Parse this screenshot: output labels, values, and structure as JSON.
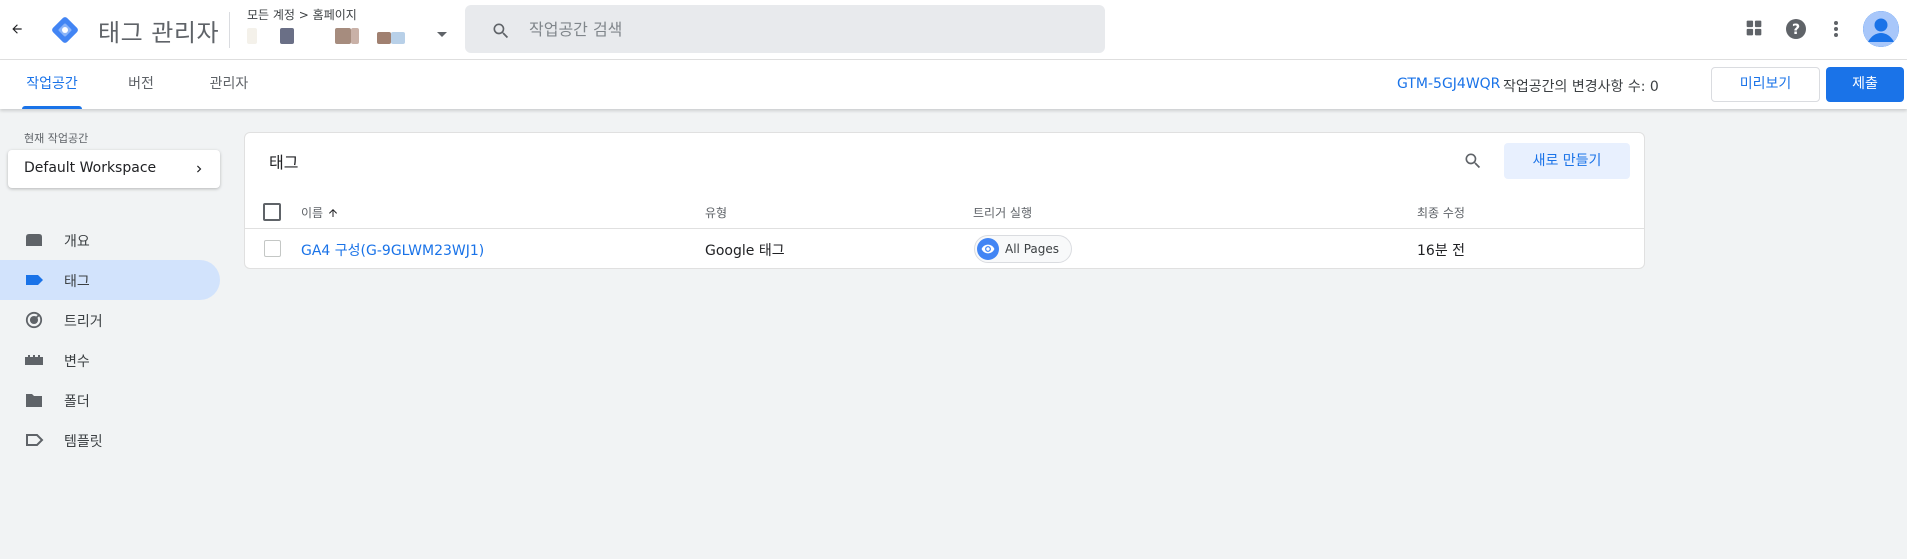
{
  "header": {
    "app_title": "태그 관리자",
    "breadcrumb": "모든 계정 > 홈페이지",
    "search_placeholder": "작업공간 검색"
  },
  "tabs": [
    {
      "label": "작업공간",
      "active": true
    },
    {
      "label": "버전",
      "active": false
    },
    {
      "label": "관리자",
      "active": false
    }
  ],
  "toolbar": {
    "container_id": "GTM-5GJ4WQR",
    "changes_label": "작업공간의 변경사항 수: 0",
    "preview_label": "미리보기",
    "submit_label": "제출"
  },
  "sidebar": {
    "workspace_caption": "현재 작업공간",
    "workspace_name": "Default Workspace",
    "items": [
      {
        "label": "개요",
        "icon": "overview-icon",
        "active": false
      },
      {
        "label": "태그",
        "icon": "tag-icon",
        "active": true
      },
      {
        "label": "트리거",
        "icon": "trigger-icon",
        "active": false
      },
      {
        "label": "변수",
        "icon": "variable-icon",
        "active": false
      },
      {
        "label": "폴더",
        "icon": "folder-icon",
        "active": false
      },
      {
        "label": "템플릿",
        "icon": "template-icon",
        "active": false
      }
    ]
  },
  "tags_table": {
    "title": "태그",
    "new_button": "새로 만들기",
    "columns": [
      "이름",
      "유형",
      "트리거 실행",
      "최종 수정"
    ],
    "rows": [
      {
        "name": "GA4 구성(G-9GLWM23WJ1)",
        "type": "Google 태그",
        "trigger": "All Pages",
        "modified": "16분 전"
      }
    ]
  },
  "colors": {
    "accent": "#1a73e8",
    "active_nav_bg": "#d2e3fc",
    "page_bg": "#f1f3f4"
  }
}
